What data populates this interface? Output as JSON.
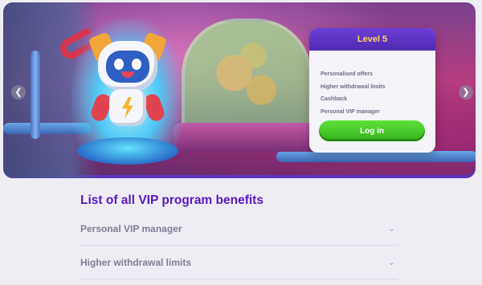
{
  "carousel": {
    "prev_icon": "chevron-left-icon",
    "next_icon": "chevron-right-icon"
  },
  "level_card": {
    "title": "Level 5",
    "benefits": [
      "Personalised offers",
      "Higher withdrawal limits",
      "Cashback",
      "Personal VIP manager"
    ],
    "login_label": "Log in"
  },
  "benefits_section": {
    "title": "List of all VIP program benefits",
    "items": [
      {
        "label": "Personal VIP manager",
        "icon": "chevron-down-icon"
      },
      {
        "label": "Higher withdrawal limits",
        "icon": "chevron-down-icon"
      }
    ]
  },
  "colors": {
    "accent_purple": "#5a18c4",
    "card_header": "#5a33c7",
    "level_text": "#ffd25c",
    "login_green": "#3fc224"
  }
}
